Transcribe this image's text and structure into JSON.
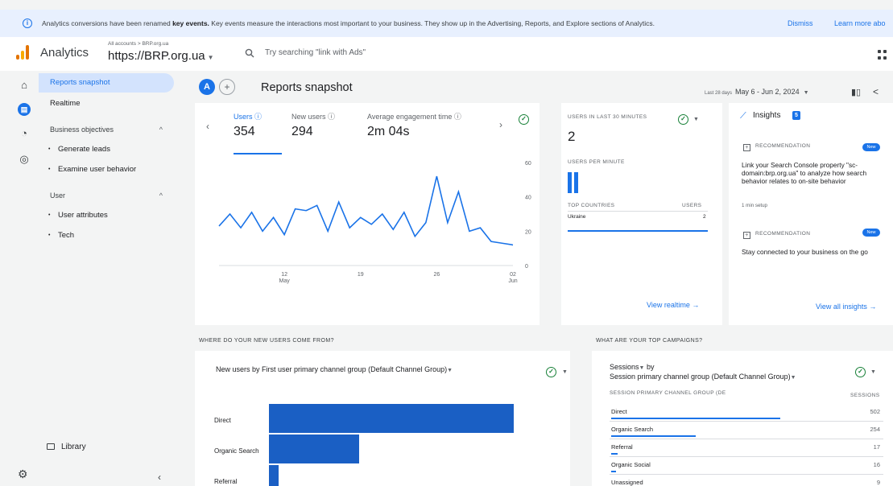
{
  "banner": {
    "text_before": "Analytics conversions have been renamed ",
    "text_bold": "key events.",
    "text_after": " Key events measure the interactions most important to your business. They show up in the Advertising, Reports, and Explore sections of Analytics.",
    "dismiss": "Dismiss",
    "learn_more": "Learn more abo"
  },
  "header": {
    "app_name": "Analytics",
    "account_path": "All accounts > BRP.org.ua",
    "property": "https://BRP.org.ua",
    "search_placeholder": "Try searching \"link with Ads\""
  },
  "nav": {
    "reports_snapshot": "Reports snapshot",
    "realtime": "Realtime",
    "business_objectives": "Business objectives",
    "generate_leads": "Generate leads",
    "examine_user_behavior": "Examine user behavior",
    "user": "User",
    "user_attributes": "User attributes",
    "tech": "Tech",
    "library": "Library"
  },
  "page": {
    "avatar_letter": "A",
    "title": "Reports snapshot",
    "date_prefix": "Last 28 days",
    "date_range": "May 6 - Jun 2, 2024"
  },
  "metrics": [
    {
      "label": "Users",
      "value": "354"
    },
    {
      "label": "New users",
      "value": "294"
    },
    {
      "label": "Average engagement time",
      "value": "2m 04s"
    }
  ],
  "chart_data": {
    "type": "line",
    "series": [
      {
        "values": [
          23,
          30,
          22,
          31,
          20,
          28,
          18,
          33,
          32,
          35,
          20,
          37,
          22,
          28,
          24,
          30,
          21,
          31,
          17,
          25,
          52,
          25,
          43,
          20,
          22,
          14,
          13,
          12
        ]
      }
    ],
    "xticks": [
      "12\nMay",
      "19",
      "26",
      "02\nJun"
    ],
    "yticks": [
      "0",
      "20",
      "40",
      "60"
    ],
    "ylim": [
      0,
      60
    ]
  },
  "realtime": {
    "users_last_30_label": "USERS IN LAST 30 MINUTES",
    "users_value": "2",
    "per_minute_label": "USERS PER MINUTE",
    "per_minute_bars": [
      1,
      1
    ],
    "top_countries_label": "TOP COUNTRIES",
    "users_col": "USERS",
    "countries": [
      {
        "name": "Ukraine",
        "value": "2"
      }
    ],
    "view_link": "View realtime"
  },
  "insights": {
    "title": "Insights",
    "count": "5",
    "rec_label": "RECOMMENDATION",
    "new_badge": "New",
    "rec1_text": "Link your Search Console property \"sc-domain:brp.org.ua\" to analyze how search behavior relates to on-site behavior",
    "rec1_sub": "1 min setup",
    "rec2_text": "Stay connected to your business on the go",
    "view_link": "View all insights"
  },
  "new_users_section": {
    "section_title": "WHERE DO YOUR NEW USERS COME FROM?",
    "chart_title": "New users by First user primary channel group (Default Channel Group)",
    "bars": [
      {
        "label": "Direct",
        "value": 1.0
      },
      {
        "label": "Organic Search",
        "value": 0.37
      },
      {
        "label": "Referral",
        "value": 0.04
      }
    ]
  },
  "campaigns": {
    "section_title": "WHAT ARE YOUR TOP CAMPAIGNS?",
    "chart_title_1": "Sessions",
    "chart_title_2": "by",
    "chart_title_3": "Session primary channel group (Default Channel Group)",
    "col1": "SESSION PRIMARY CHANNEL GROUP (DE",
    "col2": "SESSIONS",
    "rows": [
      {
        "name": "Direct",
        "value": "502",
        "share": 1.0
      },
      {
        "name": "Organic Search",
        "value": "254",
        "share": 0.5
      },
      {
        "name": "Referral",
        "value": "17",
        "share": 0.04
      },
      {
        "name": "Organic Social",
        "value": "16",
        "share": 0.03
      },
      {
        "name": "Unassigned",
        "value": "9",
        "share": 0.02
      }
    ]
  },
  "colors": {
    "accent": "#1a73e8",
    "bar": "#1a5fc4",
    "check": "#188038"
  }
}
